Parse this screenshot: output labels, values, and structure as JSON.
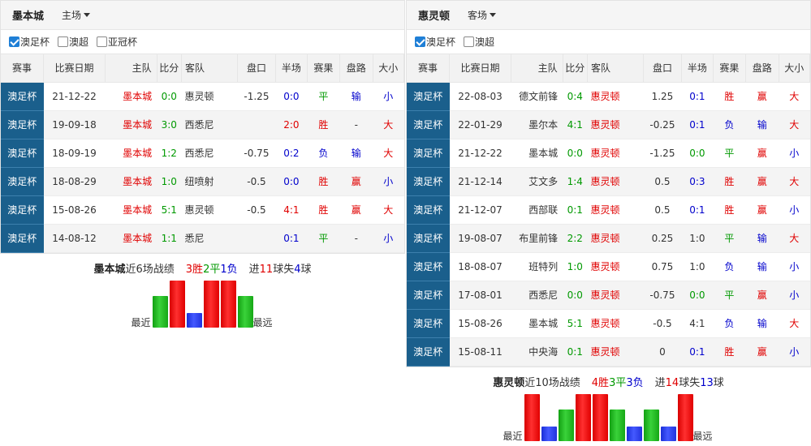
{
  "left": {
    "title": "墨本城",
    "venue": "主场",
    "filters": [
      {
        "label": "澳足杯",
        "checked": true
      },
      {
        "label": "澳超",
        "checked": false
      },
      {
        "label": "亚冠杯",
        "checked": false
      }
    ],
    "headers": [
      "赛事",
      "比赛日期",
      "主队",
      "比分",
      "客队",
      "盘口",
      "半场",
      "赛果",
      "盘路",
      "大小"
    ],
    "rows": [
      {
        "comp": "澳足杯",
        "date": "21-12-22",
        "home": "墨本城",
        "score": "0:0",
        "away": "惠灵顿",
        "line": "-1.25",
        "half": "0:0",
        "result": "平",
        "cover": "输",
        "ou": "小"
      },
      {
        "comp": "澳足杯",
        "date": "19-09-18",
        "home": "墨本城",
        "score": "3:0",
        "away": "西悉尼",
        "line": "",
        "half": "2:0",
        "result": "胜",
        "cover": "-",
        "ou": "大"
      },
      {
        "comp": "澳足杯",
        "date": "18-09-19",
        "home": "墨本城",
        "score": "1:2",
        "away": "西悉尼",
        "line": "-0.75",
        "half": "0:2",
        "result": "负",
        "cover": "输",
        "ou": "大"
      },
      {
        "comp": "澳足杯",
        "date": "18-08-29",
        "home": "墨本城",
        "score": "1:0",
        "away": "纽喷射",
        "line": "-0.5",
        "half": "0:0",
        "result": "胜",
        "cover": "赢",
        "ou": "小"
      },
      {
        "comp": "澳足杯",
        "date": "15-08-26",
        "home": "墨本城",
        "score": "5:1",
        "away": "惠灵顿",
        "line": "-0.5",
        "half": "4:1",
        "result": "胜",
        "cover": "赢",
        "ou": "大"
      },
      {
        "comp": "澳足杯",
        "date": "14-08-12",
        "home": "墨本城",
        "score": "1:1",
        "away": "悉尼",
        "line": "",
        "half": "0:1",
        "result": "平",
        "cover": "-",
        "ou": "小"
      }
    ],
    "summary": {
      "team": "墨本城",
      "desc": "近6场战绩",
      "wins": "3胜",
      "draws": "2平",
      "losses": "1负",
      "scored_pre": "进",
      "scored": "11",
      "scored_unit": "球失",
      "conceded": "4",
      "conceded_unit": "球"
    },
    "form": {
      "labels": [
        "最近",
        "最远"
      ],
      "results": [
        "d",
        "w",
        "l",
        "w",
        "w",
        "d"
      ]
    }
  },
  "right": {
    "title": "惠灵顿",
    "venue": "客场",
    "filters": [
      {
        "label": "澳足杯",
        "checked": true
      },
      {
        "label": "澳超",
        "checked": false
      }
    ],
    "headers": [
      "赛事",
      "比赛日期",
      "主队",
      "比分",
      "客队",
      "盘口",
      "半场",
      "赛果",
      "盘路",
      "大小"
    ],
    "rows": [
      {
        "comp": "澳足杯",
        "date": "22-08-03",
        "home": "德文前锋",
        "score": "0:4",
        "away": "惠灵顿",
        "line": "1.25",
        "half": "0:1",
        "result": "胜",
        "cover": "赢",
        "ou": "大"
      },
      {
        "comp": "澳足杯",
        "date": "22-01-29",
        "home": "墨尔本",
        "score": "4:1",
        "away": "惠灵顿",
        "line": "-0.25",
        "half": "0:1",
        "result": "负",
        "cover": "输",
        "ou": "大"
      },
      {
        "comp": "澳足杯",
        "date": "21-12-22",
        "home": "墨本城",
        "score": "0:0",
        "away": "惠灵顿",
        "line": "-1.25",
        "half": "0:0",
        "result": "平",
        "cover": "赢",
        "ou": "小"
      },
      {
        "comp": "澳足杯",
        "date": "21-12-14",
        "home": "艾文多",
        "score": "1:4",
        "away": "惠灵顿",
        "line": "0.5",
        "half": "0:3",
        "result": "胜",
        "cover": "赢",
        "ou": "大"
      },
      {
        "comp": "澳足杯",
        "date": "21-12-07",
        "home": "西部联",
        "score": "0:1",
        "away": "惠灵顿",
        "line": "0.5",
        "half": "0:1",
        "result": "胜",
        "cover": "赢",
        "ou": "小"
      },
      {
        "comp": "澳足杯",
        "date": "19-08-07",
        "home": "布里前锋",
        "score": "2:2",
        "away": "惠灵顿",
        "line": "0.25",
        "half": "1:0",
        "result": "平",
        "cover": "输",
        "ou": "大"
      },
      {
        "comp": "澳足杯",
        "date": "18-08-07",
        "home": "班特列",
        "score": "1:0",
        "away": "惠灵顿",
        "line": "0.75",
        "half": "1:0",
        "result": "负",
        "cover": "输",
        "ou": "小"
      },
      {
        "comp": "澳足杯",
        "date": "17-08-01",
        "home": "西悉尼",
        "score": "0:0",
        "away": "惠灵顿",
        "line": "-0.75",
        "half": "0:0",
        "result": "平",
        "cover": "赢",
        "ou": "小"
      },
      {
        "comp": "澳足杯",
        "date": "15-08-26",
        "home": "墨本城",
        "score": "5:1",
        "away": "惠灵顿",
        "line": "-0.5",
        "half": "4:1",
        "result": "负",
        "cover": "输",
        "ou": "大"
      },
      {
        "comp": "澳足杯",
        "date": "15-08-11",
        "home": "中央海",
        "score": "0:1",
        "away": "惠灵顿",
        "line": "0",
        "half": "0:1",
        "result": "胜",
        "cover": "赢",
        "ou": "小"
      }
    ],
    "summary": {
      "team": "惠灵顿",
      "desc": "近10场战绩",
      "wins": "4胜",
      "draws": "3平",
      "losses": "3负",
      "scored_pre": "进",
      "scored": "14",
      "scored_unit": "球失",
      "conceded": "13",
      "conceded_unit": "球"
    },
    "form": {
      "labels": [
        "最近",
        "最远"
      ],
      "results": [
        "w",
        "l",
        "d",
        "w",
        "w",
        "d",
        "l",
        "d",
        "l",
        "w"
      ]
    }
  },
  "colors": {
    "competition_bg": "#1a5f8c",
    "win": "#e00000",
    "draw": "#009900",
    "loss": "#0000cc"
  }
}
